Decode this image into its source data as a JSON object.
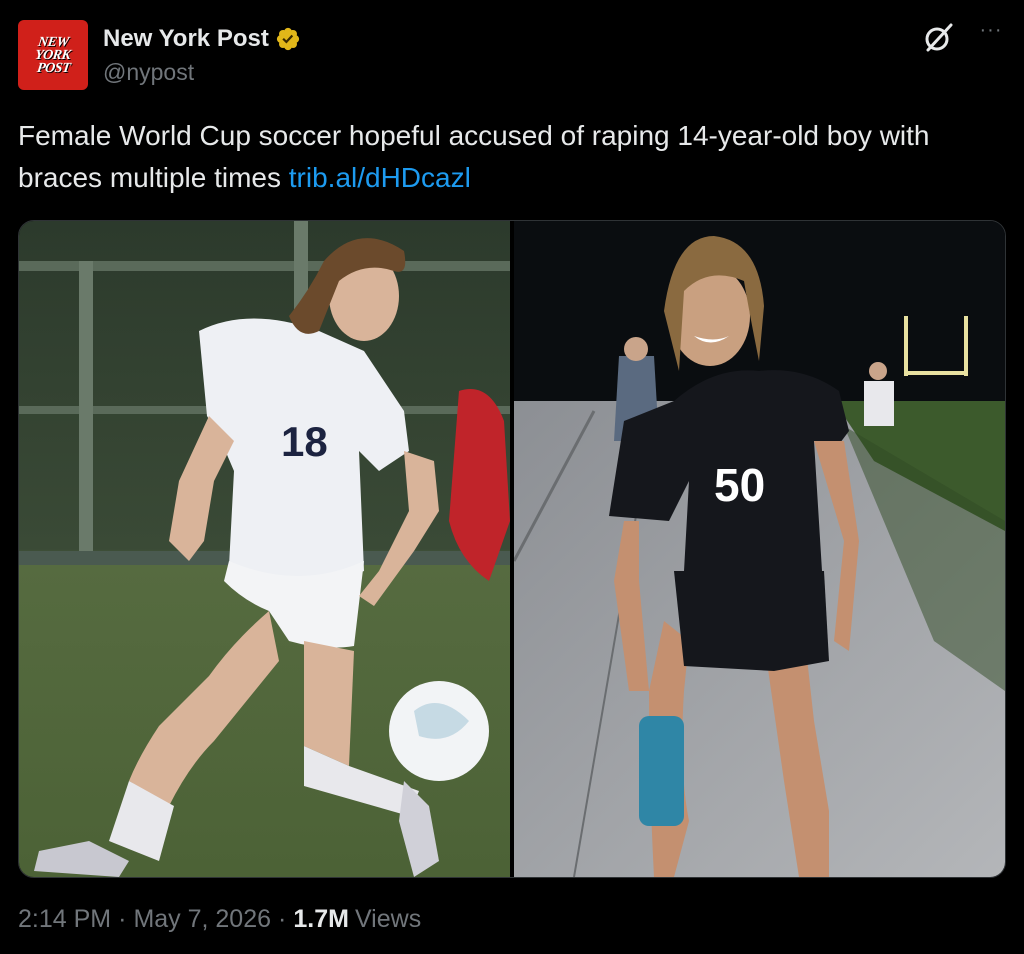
{
  "author": {
    "logo_lines": [
      "NEW",
      "YORK",
      "POST"
    ],
    "name": "New York Post",
    "handle": "@nypost",
    "verified_icon": "verified-gold-badge"
  },
  "actions": {
    "grok_icon": "grok-icon",
    "more_icon": "more-icon",
    "more_label": "···"
  },
  "tweet": {
    "text": "Female World Cup soccer hopeful accused of raping 14-year-old boy with braces multiple times",
    "link": "trib.al/dHDcazl"
  },
  "media": {
    "left_jersey_number": "18",
    "right_jersey_number": "50"
  },
  "meta": {
    "time": "2:14 PM",
    "date": "May 7, 2026",
    "views_count": "1.7M",
    "views_label": "Views",
    "separator": "·"
  },
  "colors": {
    "background": "#000000",
    "text": "#e7e9ea",
    "secondary": "#71767b",
    "link": "#1d9bf0",
    "brand_red": "#d0201a",
    "verified_gold": "#e2b719"
  }
}
